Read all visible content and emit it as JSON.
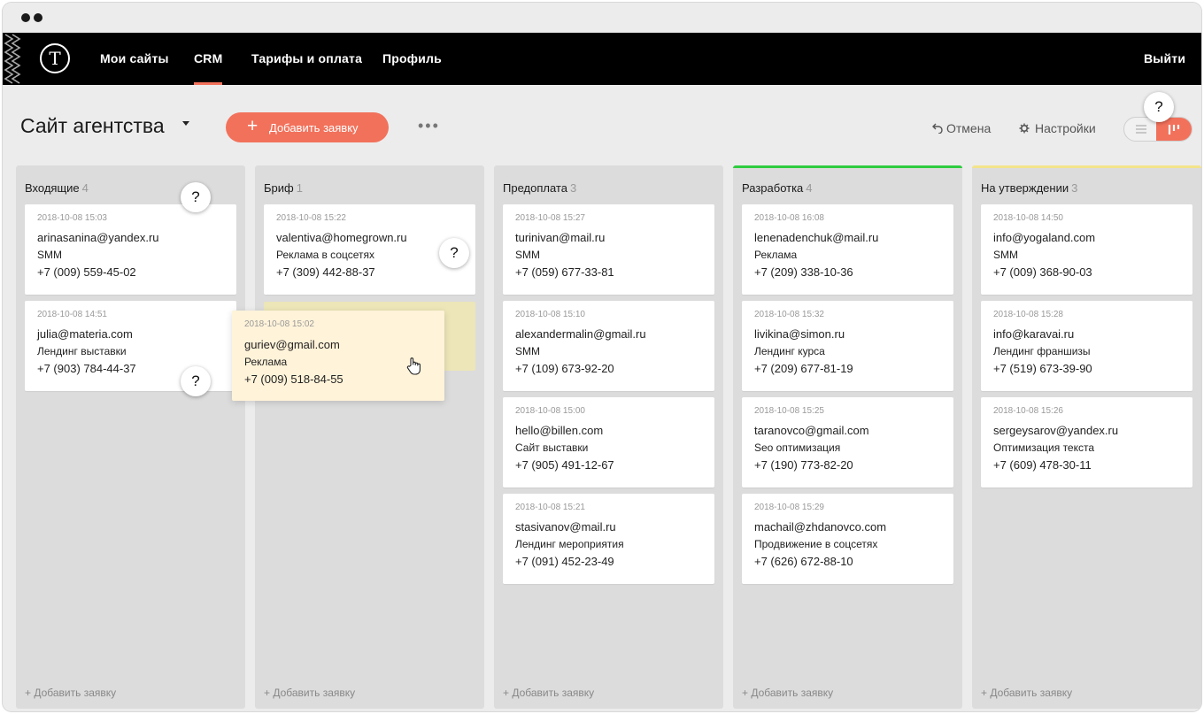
{
  "nav": {
    "logo": "T",
    "items": [
      {
        "label": "Мои сайты",
        "active": false
      },
      {
        "label": "CRM",
        "active": true
      },
      {
        "label": "Тарифы и оплата",
        "active": false
      },
      {
        "label": "Профиль",
        "active": false
      }
    ],
    "logout": "Выйти"
  },
  "toolbar": {
    "site_title": "Сайт агентства",
    "add_button": "Добавить заявку",
    "more": "•••",
    "undo": "Отмена",
    "settings": "Настройки",
    "view_mode": "kanban"
  },
  "help_icon_label": "?",
  "colors": {
    "accent": "#f2715b",
    "column_bg": "#dcdcdc",
    "dev_accent": "#2ecc40",
    "approval_accent": "#f3e48a"
  },
  "columns": [
    {
      "title": "Входящие",
      "count": "4",
      "accent": "",
      "cards": [
        {
          "date": "2018-10-08 15:03",
          "email": "arinasanina@yandex.ru",
          "service": "SMM",
          "phone": "+7 (009) 559-45-02"
        },
        {
          "date": "2018-10-08 14:51",
          "email": "julia@materia.com",
          "service": "Лендинг выставки",
          "phone": "+7 (903) 784-44-37"
        }
      ],
      "add_label": "+ Добавить заявку"
    },
    {
      "title": "Бриф",
      "count": "1",
      "accent": "",
      "cards": [
        {
          "date": "2018-10-08 15:22",
          "email": "valentiva@homegrown.ru",
          "service": "Реклама в соцсетях",
          "phone": "+7 (309) 442-88-37"
        }
      ],
      "add_label": "+ Добавить заявку"
    },
    {
      "title": "Предоплата",
      "count": "3",
      "accent": "",
      "cards": [
        {
          "date": "2018-10-08 15:27",
          "email": "turinivan@mail.ru",
          "service": "SMM",
          "phone": "+7 (059) 677-33-81"
        },
        {
          "date": "2018-10-08 15:10",
          "email": "alexandermalin@gmail.ru",
          "service": "SMM",
          "phone": "+7 (109) 673-92-20"
        },
        {
          "date": "2018-10-08 15:00",
          "email": "hello@billen.com",
          "service": "Сайт выставки",
          "phone": "+7 (905) 491-12-67"
        },
        {
          "date": "2018-10-08 15:21",
          "email": "stasivanov@mail.ru",
          "service": "Лендинг мероприятия",
          "phone": "+7 (091) 452-23-49"
        }
      ],
      "add_label": "+ Добавить заявку"
    },
    {
      "title": "Разработка",
      "count": "4",
      "accent": "#2ecc40",
      "cards": [
        {
          "date": "2018-10-08 16:08",
          "email": "lenenadenchuk@mail.ru",
          "service": "Реклама",
          "phone": "+7 (209) 338-10-36"
        },
        {
          "date": "2018-10-08 15:32",
          "email": "livikina@simon.ru",
          "service": "Лендинг курса",
          "phone": "+7 (209) 677-81-19"
        },
        {
          "date": "2018-10-08 15:25",
          "email": "taranovco@gmail.com",
          "service": "Seo оптимизация",
          "phone": "+7 (190) 773-82-20"
        },
        {
          "date": "2018-10-08 15:29",
          "email": "machail@zhdanovco.com",
          "service": "Продвижение в соцсетях",
          "phone": "+7 (626) 672-88-10"
        }
      ],
      "add_label": "+ Добавить заявку"
    },
    {
      "title": "На утверждении",
      "count": "3",
      "accent": "#f3e48a",
      "cards": [
        {
          "date": "2018-10-08 14:50",
          "email": "info@yogaland.com",
          "service": "SMM",
          "phone": "+7 (009) 368-90-03"
        },
        {
          "date": "2018-10-08 15:28",
          "email": "info@karavai.ru",
          "service": "Лендинг франшизы",
          "phone": "+7 (519) 673-39-90"
        },
        {
          "date": "2018-10-08 15:26",
          "email": "sergeysarov@yandex.ru",
          "service": "Оптимизация текста",
          "phone": "+7 (609) 478-30-11"
        }
      ],
      "add_label": "+ Добавить заявку"
    }
  ],
  "dragging_card": {
    "date": "2018-10-08 15:02",
    "email": "guriev@gmail.com",
    "service": "Реклама",
    "phone": "+7 (009) 518-84-55"
  }
}
